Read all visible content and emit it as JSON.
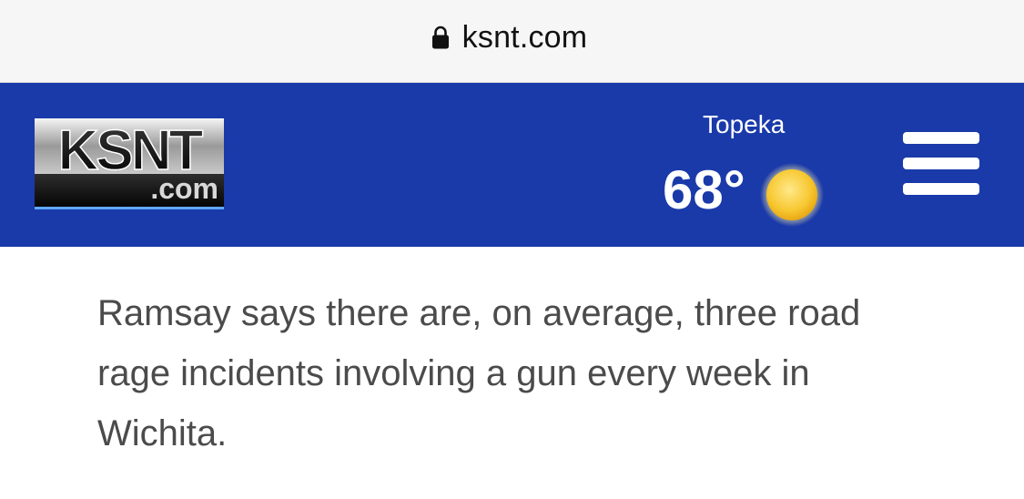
{
  "browser": {
    "url": "ksnt.com",
    "lock_icon": "lock-icon"
  },
  "header": {
    "logo": {
      "text_main": "KSNT",
      "text_sub": ".com"
    },
    "weather": {
      "city": "Topeka",
      "temperature": "68°",
      "condition_icon": "sun-icon"
    },
    "menu_icon": "hamburger-menu-icon",
    "colors": {
      "header_bg": "#1a3aaa",
      "sun": "#f7c730"
    }
  },
  "article": {
    "paragraph": "Ramsay says there are, on average, three road rage incidents involving a gun every week in Wichita."
  }
}
